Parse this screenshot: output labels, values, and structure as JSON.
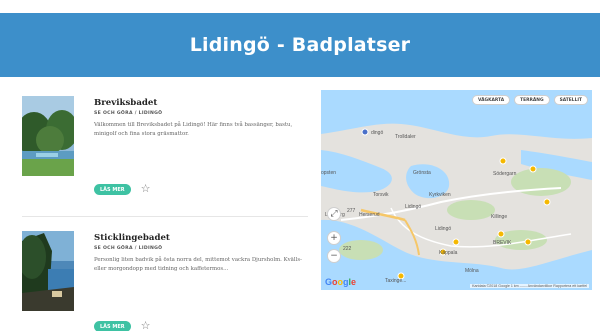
{
  "header": {
    "title": "Lidingö - Badplatser"
  },
  "places": [
    {
      "title": "Breviksbadet",
      "breadcrumb": "SE OCH GÖRA / LIDINGÖ",
      "description": "Välkommen till Breviksbadet på Lidingö! Här finns två bassänger, bastu, minigolf och fina stora gräsmattor.",
      "read_more": "LÄS MER",
      "favorite_icon": "star-outline-icon"
    },
    {
      "title": "Sticklingebadet",
      "breadcrumb": "SE OCH GÖRA / LIDINGÖ",
      "description": "Personlig liten badvik på östa norra del, mittemot vackra Djursholm. Kvälls- eller morgondopp med tidning och kaffetermos...",
      "read_more": "LÄS MER",
      "favorite_icon": "star-outline-icon"
    }
  ],
  "map": {
    "type_buttons": [
      "VÄGKARTA",
      "TERRÄNG",
      "SATELLIT"
    ],
    "labels": {
      "lidingo_top": "dingö",
      "trolldaler": "Trolldaler",
      "grönsta": "Grönsta",
      "sodergarn": "Södergarn",
      "ropsten": "opsten",
      "torsvik": "Torsvik",
      "herserud": "Herserud",
      "larsberg": "Larsberg",
      "kyrkviken": "Kyrkviken",
      "lidingo_center": "Lidingö",
      "killinge": "Killinge",
      "lidingo_south": "Lidingö",
      "mölna": "Mölna",
      "käppala": "Käppala",
      "taxi": "Taxinge...",
      "brevik": "BREVIK",
      "road_a": "277",
      "road_b": "222"
    },
    "zoom_in": "+",
    "zoom_out": "−",
    "fullscreen_icon": "expand-icon",
    "google_logo": "Google",
    "attribution": "Kartdata ©2018 Google   1 km ⎯⎯⎯⎯   Användarvillkor   Rapportera ett kartfel",
    "colors": {
      "water": "#aadaff",
      "land": "#e4e2de",
      "green": "#c8dfb5",
      "marker": "#f5b800",
      "current": "#4a70c9"
    }
  }
}
